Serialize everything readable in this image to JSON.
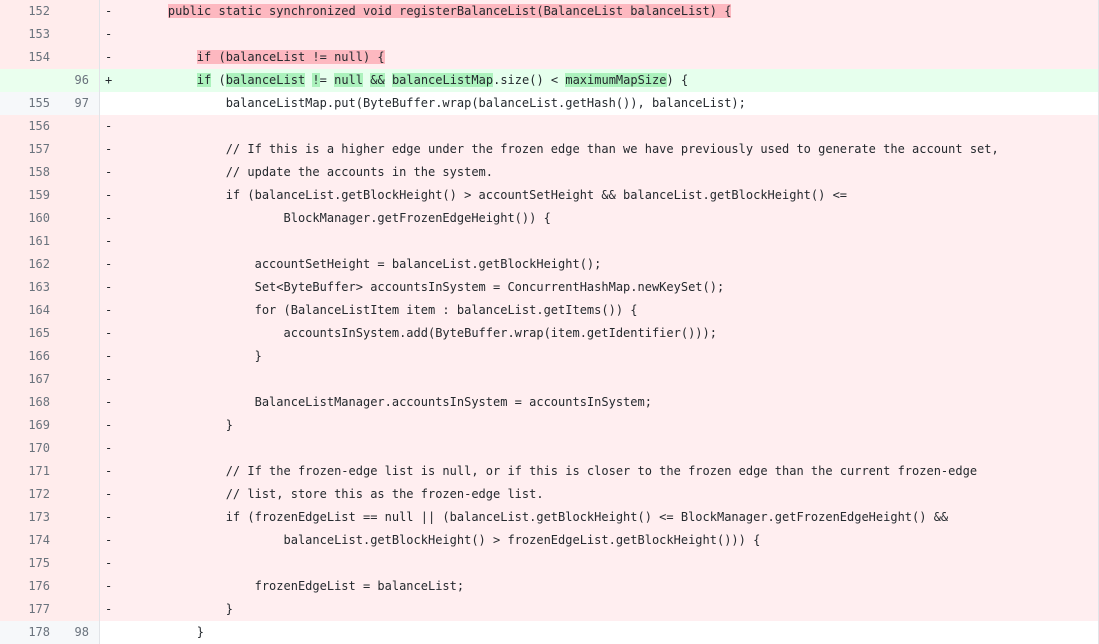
{
  "view": {
    "type": "unified-diff",
    "colors": {
      "deleted_background": "#ffeef0",
      "deleted_word_highlight": "#fdb8c0",
      "added_background": "#e6ffed",
      "added_word_highlight": "#acf2bd",
      "context_background": "#ffffff",
      "gutter_background": "#f6f8fa",
      "text": "#24292e",
      "line_number_text": "#6a737d",
      "border": "#e1e4e8"
    },
    "markers": {
      "deleted": "-",
      "added": "+",
      "context": ""
    }
  },
  "lines": [
    {
      "old": "152",
      "new": "",
      "kind": "del",
      "marker": "-",
      "segments": [
        {
          "text": "    ",
          "hl": false
        },
        {
          "text": "public static synchronized void registerBalanceList(BalanceList balanceList) {",
          "hl": true
        }
      ]
    },
    {
      "old": "153",
      "new": "",
      "kind": "del",
      "marker": "-",
      "segments": [
        {
          "text": "",
          "hl": false
        }
      ]
    },
    {
      "old": "154",
      "new": "",
      "kind": "del",
      "marker": "-",
      "segments": [
        {
          "text": "        ",
          "hl": false
        },
        {
          "text": "if (balanceList != null) {",
          "hl": true
        }
      ]
    },
    {
      "old": "",
      "new": "96",
      "kind": "add",
      "marker": "+",
      "segments": [
        {
          "text": "        ",
          "hl": false
        },
        {
          "text": "if",
          "hl": true
        },
        {
          "text": " (",
          "hl": false
        },
        {
          "text": "balanceList",
          "hl": true
        },
        {
          "text": " ",
          "hl": false
        },
        {
          "text": "!",
          "hl": true
        },
        {
          "text": "= ",
          "hl": false
        },
        {
          "text": "null",
          "hl": true
        },
        {
          "text": " ",
          "hl": false
        },
        {
          "text": "&&",
          "hl": true
        },
        {
          "text": " ",
          "hl": false
        },
        {
          "text": "balanceListMap",
          "hl": true
        },
        {
          "text": ".size() < ",
          "hl": false
        },
        {
          "text": "maximumMapSize",
          "hl": true
        },
        {
          "text": ") {",
          "hl": false
        }
      ]
    },
    {
      "old": "155",
      "new": "97",
      "kind": "ctx",
      "marker": "",
      "segments": [
        {
          "text": "            balanceListMap.put(ByteBuffer.wrap(balanceList.getHash()), balanceList);",
          "hl": false
        }
      ]
    },
    {
      "old": "156",
      "new": "",
      "kind": "del",
      "marker": "-",
      "segments": [
        {
          "text": "",
          "hl": false
        }
      ]
    },
    {
      "old": "157",
      "new": "",
      "kind": "del",
      "marker": "-",
      "segments": [
        {
          "text": "            // If this is a higher edge under the frozen edge than we have previously used to generate the account set,",
          "hl": false
        }
      ]
    },
    {
      "old": "158",
      "new": "",
      "kind": "del",
      "marker": "-",
      "segments": [
        {
          "text": "            // update the accounts in the system.",
          "hl": false
        }
      ]
    },
    {
      "old": "159",
      "new": "",
      "kind": "del",
      "marker": "-",
      "segments": [
        {
          "text": "            if (balanceList.getBlockHeight() > accountSetHeight && balanceList.getBlockHeight() <=",
          "hl": false
        }
      ]
    },
    {
      "old": "160",
      "new": "",
      "kind": "del",
      "marker": "-",
      "segments": [
        {
          "text": "                    BlockManager.getFrozenEdgeHeight()) {",
          "hl": false
        }
      ]
    },
    {
      "old": "161",
      "new": "",
      "kind": "del",
      "marker": "-",
      "segments": [
        {
          "text": "",
          "hl": false
        }
      ]
    },
    {
      "old": "162",
      "new": "",
      "kind": "del",
      "marker": "-",
      "segments": [
        {
          "text": "                accountSetHeight = balanceList.getBlockHeight();",
          "hl": false
        }
      ]
    },
    {
      "old": "163",
      "new": "",
      "kind": "del",
      "marker": "-",
      "segments": [
        {
          "text": "                Set<ByteBuffer> accountsInSystem = ConcurrentHashMap.newKeySet();",
          "hl": false
        }
      ]
    },
    {
      "old": "164",
      "new": "",
      "kind": "del",
      "marker": "-",
      "segments": [
        {
          "text": "                for (BalanceListItem item : balanceList.getItems()) {",
          "hl": false
        }
      ]
    },
    {
      "old": "165",
      "new": "",
      "kind": "del",
      "marker": "-",
      "segments": [
        {
          "text": "                    accountsInSystem.add(ByteBuffer.wrap(item.getIdentifier()));",
          "hl": false
        }
      ]
    },
    {
      "old": "166",
      "new": "",
      "kind": "del",
      "marker": "-",
      "segments": [
        {
          "text": "                }",
          "hl": false
        }
      ]
    },
    {
      "old": "167",
      "new": "",
      "kind": "del",
      "marker": "-",
      "segments": [
        {
          "text": "",
          "hl": false
        }
      ]
    },
    {
      "old": "168",
      "new": "",
      "kind": "del",
      "marker": "-",
      "segments": [
        {
          "text": "                BalanceListManager.accountsInSystem = accountsInSystem;",
          "hl": false
        }
      ]
    },
    {
      "old": "169",
      "new": "",
      "kind": "del",
      "marker": "-",
      "segments": [
        {
          "text": "            }",
          "hl": false
        }
      ]
    },
    {
      "old": "170",
      "new": "",
      "kind": "del",
      "marker": "-",
      "segments": [
        {
          "text": "",
          "hl": false
        }
      ]
    },
    {
      "old": "171",
      "new": "",
      "kind": "del",
      "marker": "-",
      "segments": [
        {
          "text": "            // If the frozen-edge list is null, or if this is closer to the frozen edge than the current frozen-edge",
          "hl": false
        }
      ]
    },
    {
      "old": "172",
      "new": "",
      "kind": "del",
      "marker": "-",
      "segments": [
        {
          "text": "            // list, store this as the frozen-edge list.",
          "hl": false
        }
      ]
    },
    {
      "old": "173",
      "new": "",
      "kind": "del",
      "marker": "-",
      "segments": [
        {
          "text": "            if (frozenEdgeList == null || (balanceList.getBlockHeight() <= BlockManager.getFrozenEdgeHeight() &&",
          "hl": false
        }
      ]
    },
    {
      "old": "174",
      "new": "",
      "kind": "del",
      "marker": "-",
      "segments": [
        {
          "text": "                    balanceList.getBlockHeight() > frozenEdgeList.getBlockHeight())) {",
          "hl": false
        }
      ]
    },
    {
      "old": "175",
      "new": "",
      "kind": "del",
      "marker": "-",
      "segments": [
        {
          "text": "",
          "hl": false
        }
      ]
    },
    {
      "old": "176",
      "new": "",
      "kind": "del",
      "marker": "-",
      "segments": [
        {
          "text": "                frozenEdgeList = balanceList;",
          "hl": false
        }
      ]
    },
    {
      "old": "177",
      "new": "",
      "kind": "del",
      "marker": "-",
      "segments": [
        {
          "text": "            }",
          "hl": false
        }
      ]
    },
    {
      "old": "178",
      "new": "98",
      "kind": "ctx",
      "marker": "",
      "segments": [
        {
          "text": "        }",
          "hl": false
        }
      ]
    }
  ]
}
